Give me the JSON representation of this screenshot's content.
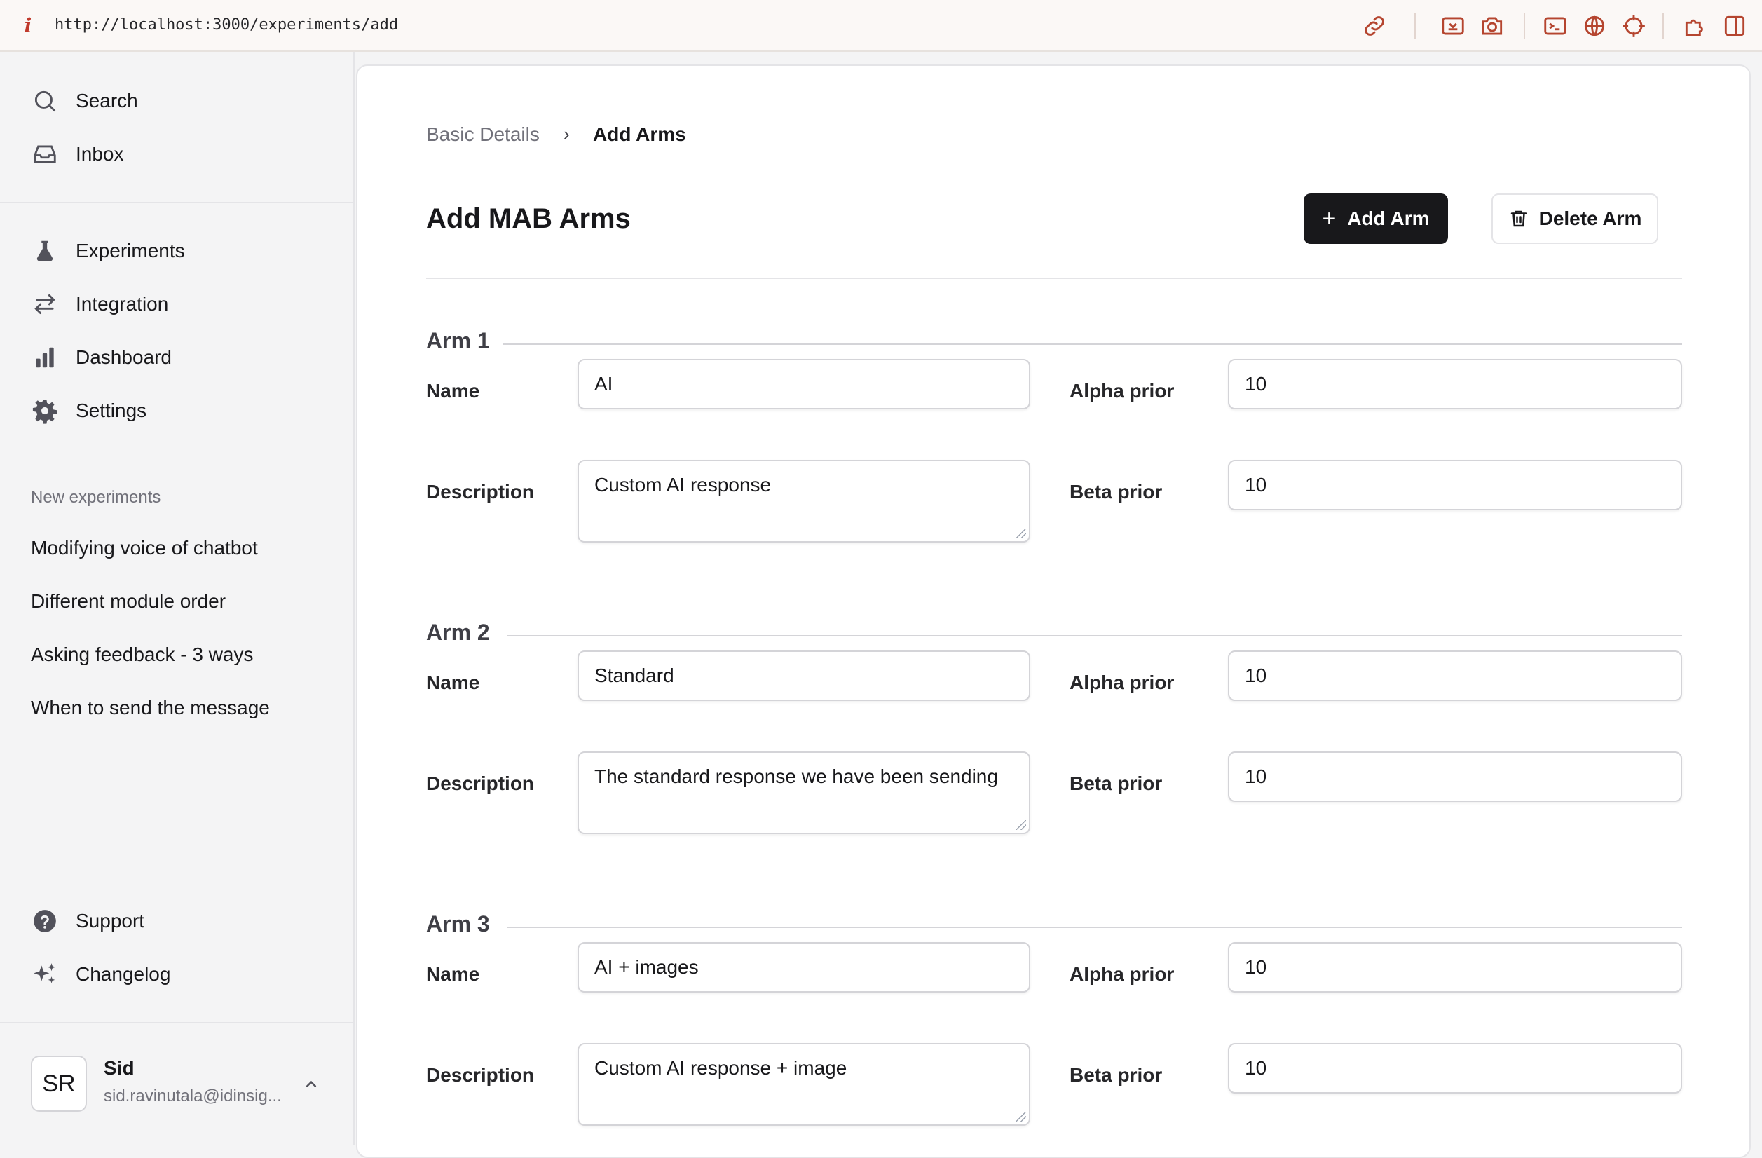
{
  "browser": {
    "url": "http://localhost:3000/experiments/add",
    "info_glyph": "i",
    "toolbar_icons": [
      "link-icon",
      "screenshot-icon",
      "camera-icon",
      "terminal-icon",
      "globe-icon",
      "crosshair-icon",
      "extension-icon",
      "sidebar-toggle-icon"
    ]
  },
  "sidebar": {
    "top": [
      {
        "label": "Search",
        "icon": "search-icon"
      },
      {
        "label": "Inbox",
        "icon": "inbox-icon"
      }
    ],
    "nav": [
      {
        "label": "Experiments",
        "icon": "flask-icon"
      },
      {
        "label": "Integration",
        "icon": "arrows-swap-icon"
      },
      {
        "label": "Dashboard",
        "icon": "bar-chart-icon"
      },
      {
        "label": "Settings",
        "icon": "gear-icon"
      }
    ],
    "section_label": "New experiments",
    "experiments": [
      "Modifying voice of chatbot",
      "Different module order",
      "Asking feedback - 3 ways",
      "When to send the message"
    ],
    "bottom": [
      {
        "label": "Support",
        "icon": "help-circle-icon"
      },
      {
        "label": "Changelog",
        "icon": "sparkles-icon"
      }
    ],
    "user": {
      "initials": "SR",
      "name": "Sid",
      "email": "sid.ravinutala@idinsig..."
    }
  },
  "main": {
    "breadcrumb": {
      "step1": "Basic Details",
      "separator": "›",
      "step2": "Add Arms"
    },
    "title": "Add MAB Arms",
    "add_button": "Add Arm",
    "add_button_glyph": "+",
    "delete_button": "Delete Arm",
    "labels": {
      "name": "Name",
      "description": "Description",
      "alpha": "Alpha prior",
      "beta": "Beta prior"
    },
    "arms": [
      {
        "title": "Arm 1",
        "name": "AI",
        "description": "Custom AI response",
        "alpha": "10",
        "beta": "10"
      },
      {
        "title": "Arm 2",
        "name": "Standard",
        "description": "The standard response we have been sending",
        "alpha": "10",
        "beta": "10"
      },
      {
        "title": "Arm 3",
        "name": "AI + images",
        "description": "Custom AI response + image",
        "alpha": "10",
        "beta": "10"
      }
    ]
  }
}
